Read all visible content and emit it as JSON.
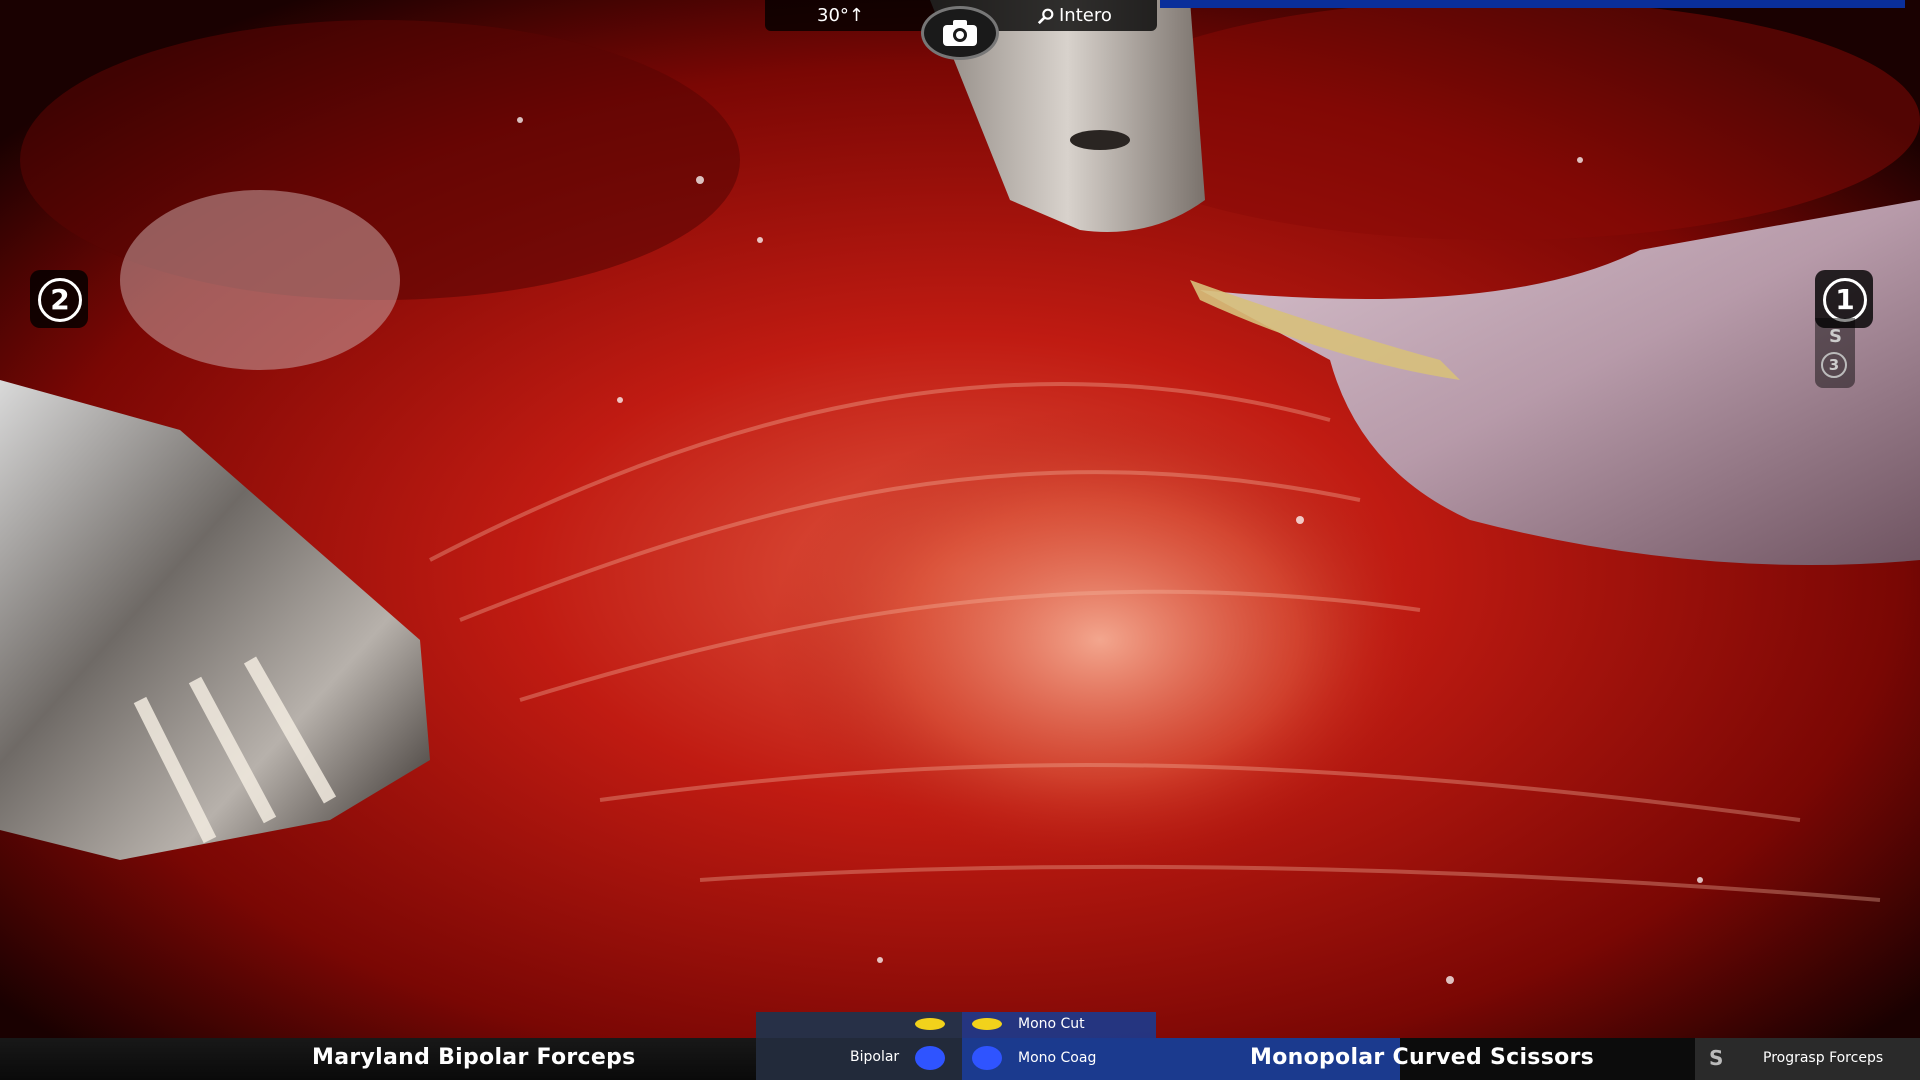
{
  "topbar": {
    "scope_angle": "30°↑",
    "view_mode": "Intero",
    "zoom_icon": "magnifier-icon",
    "camera_icon": "camera-icon"
  },
  "arms": {
    "left_arm": "2",
    "right_arm": "1",
    "swap_indicator": "S",
    "third_arm": "3"
  },
  "bottom": {
    "left_tool": "Maryland Bipolar Forceps",
    "bipolar_label": "Bipolar",
    "mono_cut_label": "Mono Cut",
    "mono_coag_label": "Mono Coag",
    "right_tool": "Monopolar Curved Scissors",
    "third_swap_icon": "S",
    "third_tool": "Prograsp Forceps"
  },
  "colors": {
    "cut_pedal": "#f2d21b",
    "coag_pedal": "#2f54ff",
    "accent_blue": "#1b3a8e"
  }
}
